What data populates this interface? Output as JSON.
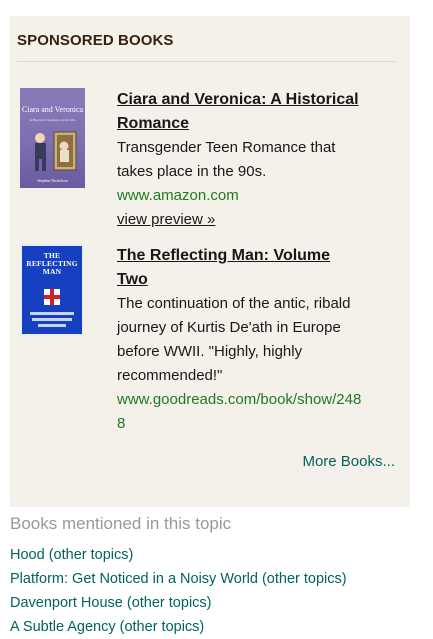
{
  "sponsored": {
    "title": "SPONSORED BOOKS",
    "books": [
      {
        "title": "Ciara and Veronica: A Historical Romance",
        "description": "Transgender Teen Romance that takes place in the 90s.",
        "url": "www.amazon.com",
        "preview_label": "view preview »",
        "cover": {
          "title": "Ciara and Veronica",
          "subtitle": "A Historical Romance of the 90s",
          "author": "Stephen Nicholson",
          "color": "#7d6fb0"
        }
      },
      {
        "title": "The Reflecting Man: Volume Two",
        "description": "The continuation of the antic, ribald journey of Kurtis De'ath in Europe before WWII. \"Highly, highly recommended!\"",
        "url": "www.goodreads.com/book/show/2488",
        "cover": {
          "title": "THE REFLECTING MAN",
          "color": "#1640c0"
        }
      }
    ],
    "more_label": "More Books..."
  },
  "mentioned": {
    "title": "Books mentioned in this topic",
    "other_label": "(other topics)",
    "items": [
      {
        "title": "Hood"
      },
      {
        "title": "Platform: Get Noticed in a Noisy World"
      },
      {
        "title": "Davenport House"
      },
      {
        "title": "A Subtle Agency"
      }
    ]
  }
}
